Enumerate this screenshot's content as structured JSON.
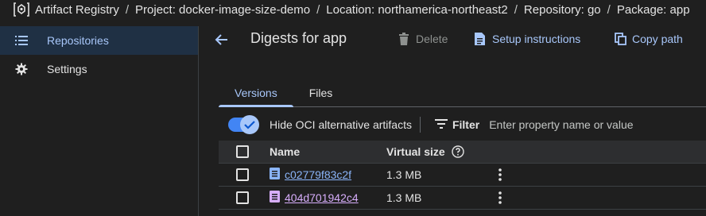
{
  "breadcrumb": {
    "items": [
      "Artifact Registry",
      "Project: docker-image-size-demo",
      "Location: northamerica-northeast2",
      "Repository: go",
      "Package: app"
    ],
    "separator": "/"
  },
  "sidebar": {
    "items": [
      {
        "label": "Repositories",
        "icon": "list-icon",
        "active": true
      },
      {
        "label": "Settings",
        "icon": "gear-icon",
        "active": false
      }
    ]
  },
  "header": {
    "title": "Digests for app",
    "delete_label": "Delete",
    "setup_label": "Setup instructions",
    "copy_label": "Copy path"
  },
  "tabs": [
    {
      "label": "Versions",
      "active": true
    },
    {
      "label": "Files",
      "active": false
    }
  ],
  "filterbar": {
    "toggle_label": "Hide OCI alternative artifacts",
    "toggle_on": true,
    "filter_label": "Filter",
    "filter_placeholder": "Enter property name or value"
  },
  "table": {
    "columns": [
      "Name",
      "Virtual size"
    ],
    "rows": [
      {
        "name": "c02779f83c2f",
        "size": "1.3 MB"
      },
      {
        "name": "404d701942c4",
        "size": "1.3 MB"
      }
    ]
  },
  "colors": {
    "background": "#1f1f1f",
    "accent": "#a8c7fa",
    "link_blue": "#8ab4f8",
    "link_visited": "#d7aefb",
    "toggle": "#4285f4"
  }
}
